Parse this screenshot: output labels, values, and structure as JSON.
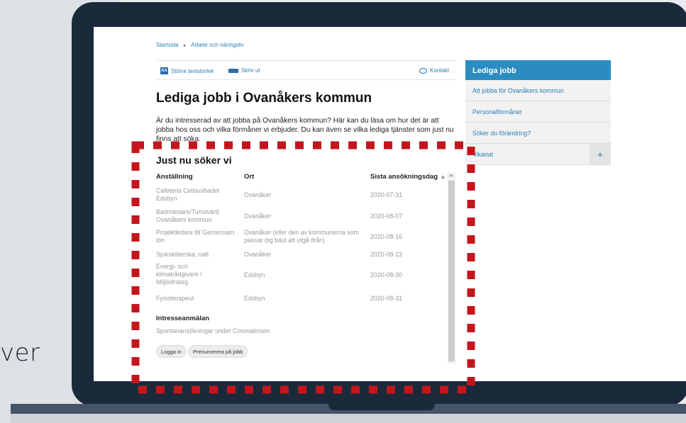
{
  "side_text": "ver",
  "breadcrumb": {
    "home": "Startsida",
    "separator": "▸",
    "current": "Arbete och näringsliv"
  },
  "toolbar": {
    "aa_icon": "AA",
    "text_size_label": "Större textstorlek",
    "print_label": "Skriv ut",
    "contact_label": "Kontakt"
  },
  "page": {
    "title": "Lediga jobb i Ovanåkers kommun",
    "intro": "Är du intresserad av att jobba på Ovanåkers kommun? Här kan du läsa om hur det är att jobba hos oss och vilka förmåner vi erbjuder. Du kan även se vilka lediga tjänster som just nu finns att söka."
  },
  "jobs": {
    "heading": "Just nu söker vi",
    "columns": [
      "Anställning",
      "Ort",
      "Sista ansökningsdag"
    ],
    "sort_icon": "sort-icon",
    "rows": [
      {
        "title": "Cafeteria Celsiusbadet Edsbyn",
        "place": "Ovanåker",
        "deadline": "2020-07-31"
      },
      {
        "title": "Badmästare/Turistvärd Ovanåkers kommun",
        "place": "Ovanåker",
        "deadline": "2020-08-07"
      },
      {
        "title": "Projektledare till Gemensam lön",
        "place": "Ovanåker (eller den av kommunerna som passar dig bäst att utgå ifrån)",
        "deadline": "2020-08-16"
      },
      {
        "title": "Sjuksköterska, natt",
        "place": "Ovanåker",
        "deadline": "2020-08-23"
      },
      {
        "title": "Energi- och klimatrådgivare / Miljöstrateg",
        "place": "Edsbyn",
        "deadline": "2020-08-30"
      },
      {
        "title": "Fysioterapeut",
        "place": "Edsbyn",
        "deadline": "2020-08-31"
      }
    ]
  },
  "interest": {
    "heading": "Intresseanmälan",
    "text": "Spontanansökningar under Coronakrisen"
  },
  "buttons": {
    "login": "Logga in",
    "subscribe": "Prenumerera på jobb"
  },
  "sidebar": {
    "title": "Lediga jobb",
    "items": [
      {
        "label": "Att jobba för Ovanåkers kommun"
      },
      {
        "label": "Personalförmåner"
      },
      {
        "label": "Söker du förändring?"
      },
      {
        "label": "Vikariat",
        "expand": "+"
      }
    ]
  },
  "colors": {
    "accent": "#2a8cc0",
    "link": "#2a7fb5",
    "highlight_dots": "#c4151c",
    "laptop": "#1b2a3a"
  }
}
